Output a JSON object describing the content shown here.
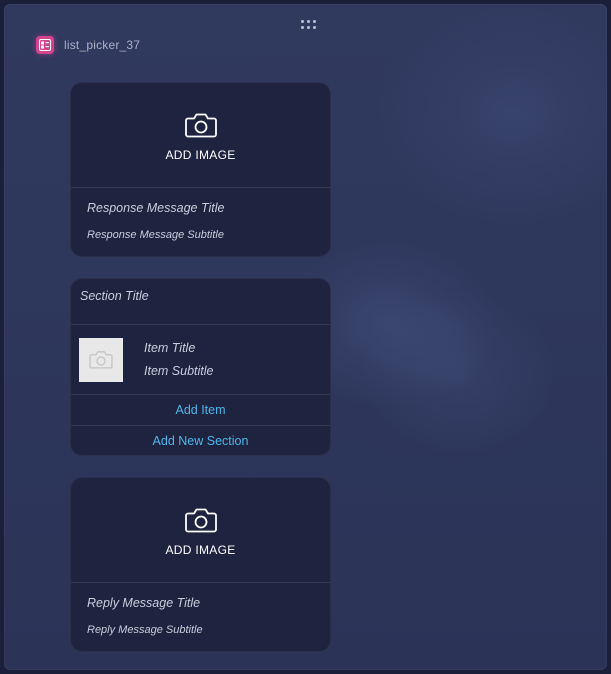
{
  "node": {
    "title": "list_picker_37",
    "icon": "list-picker-icon",
    "accent_color": "#d2448f"
  },
  "drag_handle": {
    "icon": "drag-handle-icon"
  },
  "response_card": {
    "add_image_label": "ADD IMAGE",
    "icon": "camera-icon",
    "title": "Response Message Title",
    "subtitle": "Response Message Subtitle"
  },
  "section_card": {
    "section_title": "Section Title",
    "items": [
      {
        "thumb_icon": "camera-icon",
        "title": "Item Title",
        "subtitle": "Item Subtitle"
      }
    ],
    "add_item_label": "Add Item",
    "add_section_label": "Add New Section",
    "link_color": "#4fb6ea"
  },
  "reply_card": {
    "add_image_label": "ADD IMAGE",
    "icon": "camera-icon",
    "title": "Reply Message Title",
    "subtitle": "Reply Message Subtitle"
  }
}
